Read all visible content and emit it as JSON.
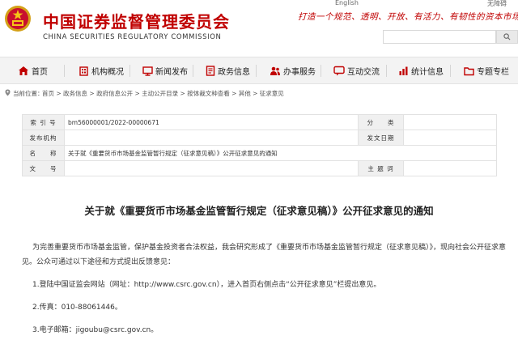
{
  "header": {
    "org_name_cn": "中国证券监督管理委员会",
    "org_name_en": "CHINA SECURITIES REGULATORY COMMISSION",
    "slogan": "打造一个规范、透明、开放、有活力、有韧性的资本市场",
    "top_links": [
      "English",
      "无障碍"
    ],
    "search_placeholder": "",
    "colors": {
      "brand_red": "#c00000",
      "nav_icon": "#c00000"
    }
  },
  "nav": {
    "items": [
      {
        "label": "首页",
        "icon": "home-icon"
      },
      {
        "label": "机构概况",
        "icon": "building-icon"
      },
      {
        "label": "新闻发布",
        "icon": "monitor-icon"
      },
      {
        "label": "政务信息",
        "icon": "document-icon"
      },
      {
        "label": "办事服务",
        "icon": "people-icon"
      },
      {
        "label": "互动交流",
        "icon": "chat-icon"
      },
      {
        "label": "统计信息",
        "icon": "chart-icon"
      },
      {
        "label": "专题专栏",
        "icon": "folder-icon"
      }
    ]
  },
  "breadcrumb": {
    "label": "当前位置：",
    "path": "首页 > 政务信息 > 政府信息公开 > 主动公开目录 > 按体裁文种查看 > 其他 > 征求意见"
  },
  "meta": {
    "index_label": "索 引 号",
    "index_value": "bm56000001/2022-00000671",
    "category_label": "分　　类",
    "category_value": "",
    "publisher_label": "发布机构",
    "publisher_value": "",
    "date_label": "发文日期",
    "date_value": "",
    "name_label": "名　　称",
    "name_value": "关于就《重要货币市场基金监管暂行规定（征求意见稿）》公开征求意见的通知",
    "docno_label": "文　　号",
    "docno_value": "",
    "subject_label": "主 题 词",
    "subject_value": ""
  },
  "article": {
    "title": "关于就《重要货币市场基金监管暂行规定（征求意见稿）》公开征求意见的通知",
    "para1_line1": "为完善重要货币市场基金监管，保护基金投资者合法权益，我会研究形成了《重要货币市场基金监管暂行规定（征求意见稿）》，现向社会公开征求意",
    "para1_line2": "见。公众可通过以下途径和方式提出反馈意见：",
    "item1": "1.登陆中国证监会网站（网址：http://www.csrc.gov.cn），进入首页右侧点击“公开征求意见”栏提出意见。",
    "item2": "2.传真：010-88061446。",
    "item3": "3.电子邮箱：jigoubu@csrc.gov.cn。"
  }
}
